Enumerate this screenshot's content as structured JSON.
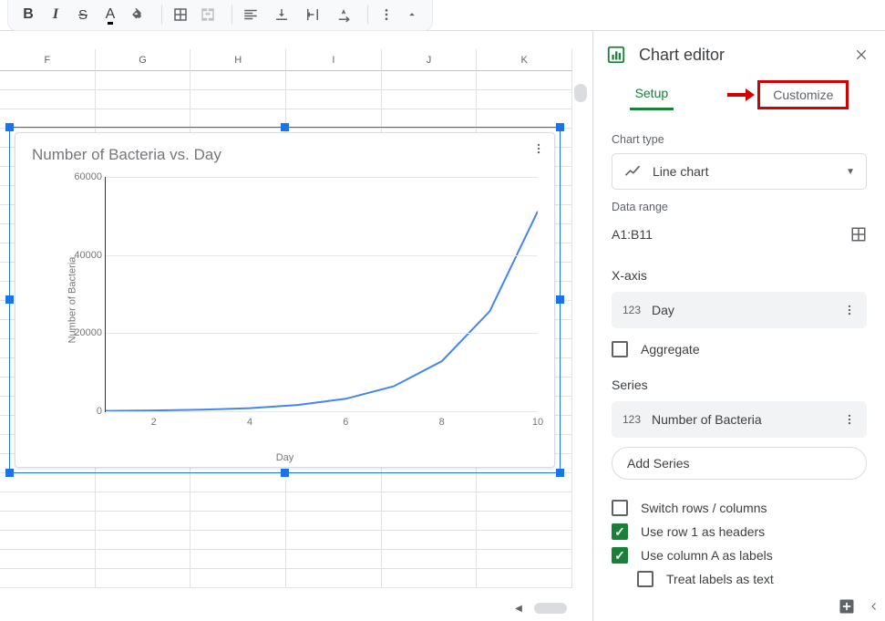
{
  "toolbar": {
    "bold": "B",
    "italic": "I",
    "strike": "S",
    "textcolor_glyph": "A"
  },
  "columns": [
    "F",
    "G",
    "H",
    "I",
    "J",
    "K"
  ],
  "chart_data": {
    "type": "line",
    "title": "Number of Bacteria vs. Day",
    "xlabel": "Day",
    "ylabel": "Number of Bacteria",
    "x": [
      1,
      2,
      3,
      4,
      5,
      6,
      7,
      8,
      9,
      10
    ],
    "values": [
      100,
      200,
      400,
      800,
      1600,
      3200,
      6400,
      12800,
      25600,
      51200
    ],
    "x_ticks": [
      2,
      4,
      6,
      8,
      10
    ],
    "y_ticks": [
      0,
      20000,
      40000,
      60000
    ],
    "ylim": [
      0,
      60000
    ],
    "xlim": [
      1,
      10
    ]
  },
  "panel": {
    "title": "Chart editor",
    "tabs": {
      "setup": "Setup",
      "customize": "Customize"
    },
    "chart_type_label": "Chart type",
    "chart_type_value": "Line chart",
    "data_range_label": "Data range",
    "data_range_value": "A1:B11",
    "xaxis_label": "X-axis",
    "xaxis_value": "Day",
    "aggregate_label": "Aggregate",
    "series_label": "Series",
    "series_value": "Number of Bacteria",
    "add_series": "Add Series",
    "switch_rows": "Switch rows / columns",
    "use_row1": "Use row 1 as headers",
    "use_colA": "Use column A as labels",
    "treat_labels": "Treat labels as text"
  }
}
